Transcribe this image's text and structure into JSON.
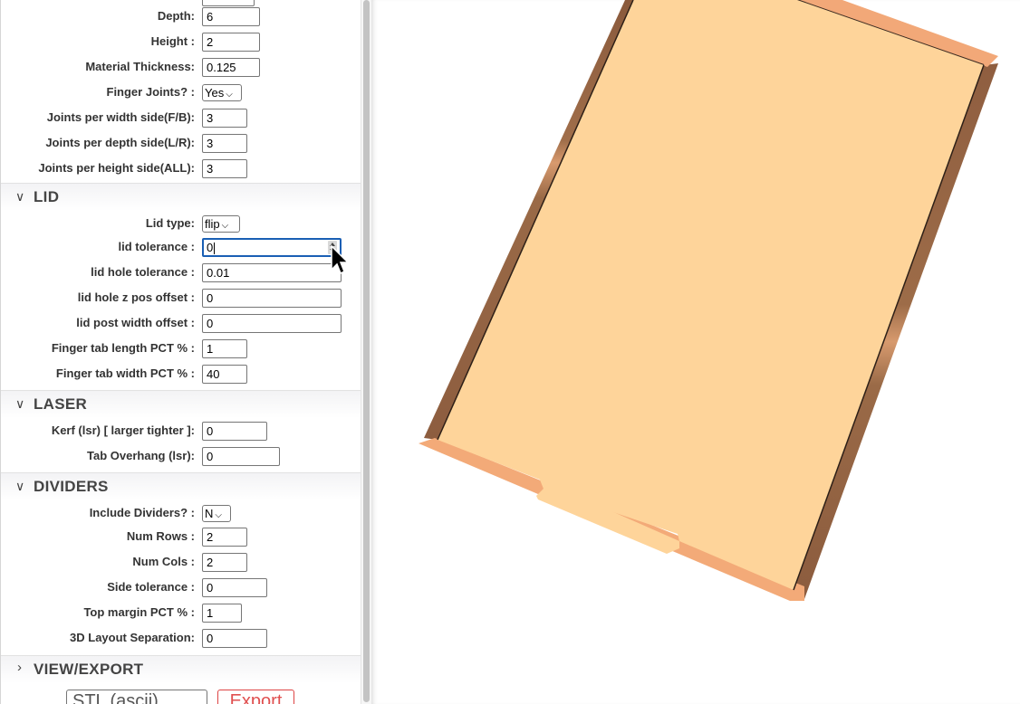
{
  "dims": {
    "width_top_value": "",
    "fields": [
      {
        "label": "Depth:",
        "value": "6"
      },
      {
        "label": "Height :",
        "value": "2"
      },
      {
        "label": "Material Thickness:",
        "value": "0.125"
      },
      {
        "label": "Finger Joints? :",
        "value": "Yes"
      },
      {
        "label": "Joints per width side(F/B):",
        "value": "3"
      },
      {
        "label": "Joints per depth side(L/R):",
        "value": "3"
      },
      {
        "label": "Joints per height side(ALL):",
        "value": "3"
      }
    ]
  },
  "lid": {
    "title": "LID",
    "fields": [
      {
        "label": "Lid type:",
        "value": "flip"
      },
      {
        "label": "lid tolerance :",
        "value": "0"
      },
      {
        "label": "lid hole tolerance :",
        "value": "0.01"
      },
      {
        "label": "lid hole z pos offset :",
        "value": "0"
      },
      {
        "label": "lid post width offset :",
        "value": "0"
      },
      {
        "label": "Finger tab length PCT % :",
        "value": "1"
      },
      {
        "label": "Finger tab width PCT % :",
        "value": "40"
      }
    ]
  },
  "laser": {
    "title": "LASER",
    "fields": [
      {
        "label": "Kerf (lsr) [ larger tighter ]:",
        "value": "0"
      },
      {
        "label": "Tab Overhang (lsr):",
        "value": "0"
      }
    ]
  },
  "dividers": {
    "title": "DIVIDERS",
    "fields": [
      {
        "label": "Include Dividers? :",
        "value": "N"
      },
      {
        "label": "Num Rows :",
        "value": "2"
      },
      {
        "label": "Num Cols :",
        "value": "2"
      },
      {
        "label": "Side tolerance :",
        "value": "0"
      },
      {
        "label": "Top margin PCT % :",
        "value": "1"
      },
      {
        "label": "3D Layout Separation:",
        "value": "0"
      }
    ]
  },
  "view_export": {
    "title": "VIEW/EXPORT",
    "format_value": "STL (ascii)",
    "export_label": "Export"
  },
  "colors": {
    "box_top": "#fed49a",
    "box_edge_dark": "#9a6a47",
    "box_edge_light": "#f7b07c",
    "focus_border": "#1a5fb4",
    "export_red": "#e05050"
  }
}
